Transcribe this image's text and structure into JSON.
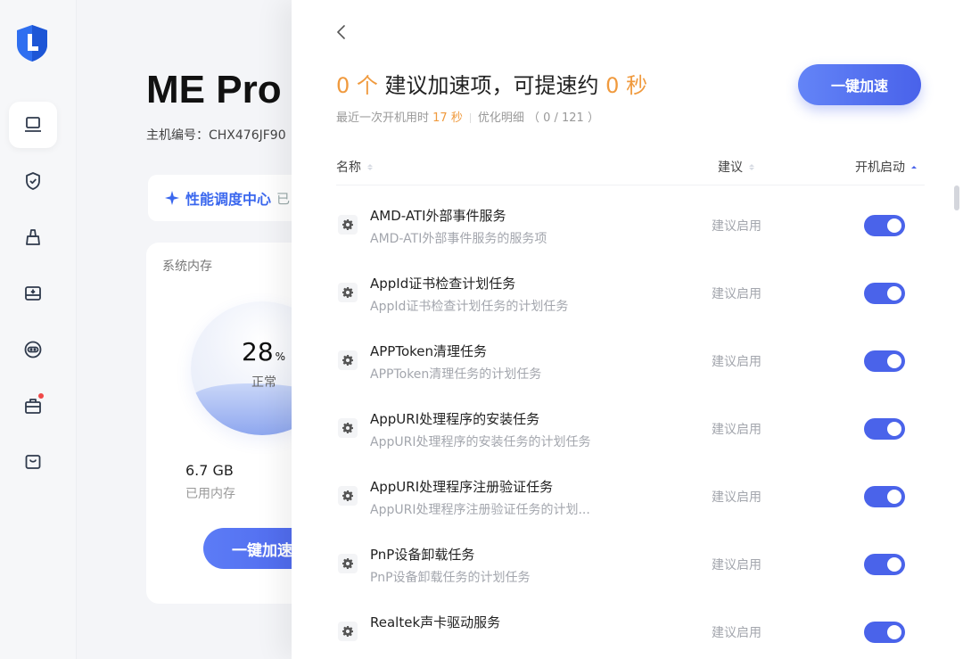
{
  "sidebar": {
    "nav": [
      {
        "icon": "laptop-icon",
        "active": true
      },
      {
        "icon": "shield-check-icon"
      },
      {
        "icon": "broom-icon"
      },
      {
        "icon": "drive-icon"
      },
      {
        "icon": "chat-bubble-icon"
      },
      {
        "icon": "toolbox-icon",
        "badge": true
      },
      {
        "icon": "bag-icon"
      }
    ]
  },
  "background": {
    "title": "ME Pro",
    "host_label": "主机编号：CHX476JF90",
    "perf_center_label": "性能调度中心",
    "perf_center_suffix": "已",
    "memory_card_title": "系统内存",
    "memory_percent": "28",
    "memory_percent_unit": "%",
    "memory_status": "正常",
    "used_memory_value": "6.7 GB",
    "used_memory_label": "已用内存",
    "accel_button_label": "一键加速"
  },
  "panel": {
    "headline": {
      "count": "0 个",
      "text1": " 建议加速项，可提速约 ",
      "seconds": "0 秒"
    },
    "subline": {
      "boot_text": "最近一次开机用时 ",
      "boot_seconds": "17 秒",
      "opt_text": "优化明细 （ 0 / 121 ）"
    },
    "accel_button_label": "一键加速",
    "columns": {
      "name": "名称",
      "suggestion": "建议",
      "startup": "开机启动"
    },
    "rows": [
      {
        "name": "AMD-ATI外部事件服务",
        "desc": "AMD-ATI外部事件服务的服务项",
        "suggestion": "建议启用",
        "enabled": true
      },
      {
        "name": "AppId证书检查计划任务",
        "desc": "AppId证书检查计划任务的计划任务",
        "suggestion": "建议启用",
        "enabled": true
      },
      {
        "name": "APPToken清理任务",
        "desc": "APPToken清理任务的计划任务",
        "suggestion": "建议启用",
        "enabled": true
      },
      {
        "name": "AppURI处理程序的安装任务",
        "desc": "AppURI处理程序的安装任务的计划任务",
        "suggestion": "建议启用",
        "enabled": true
      },
      {
        "name": "AppURI处理程序注册验证任务",
        "desc": "AppURI处理程序注册验证任务的计划...",
        "suggestion": "建议启用",
        "enabled": true
      },
      {
        "name": "PnP设备卸载任务",
        "desc": "PnP设备卸载任务的计划任务",
        "suggestion": "建议启用",
        "enabled": true
      },
      {
        "name": "Realtek声卡驱动服务",
        "desc": "",
        "suggestion": "建议启用",
        "enabled": true
      }
    ]
  }
}
